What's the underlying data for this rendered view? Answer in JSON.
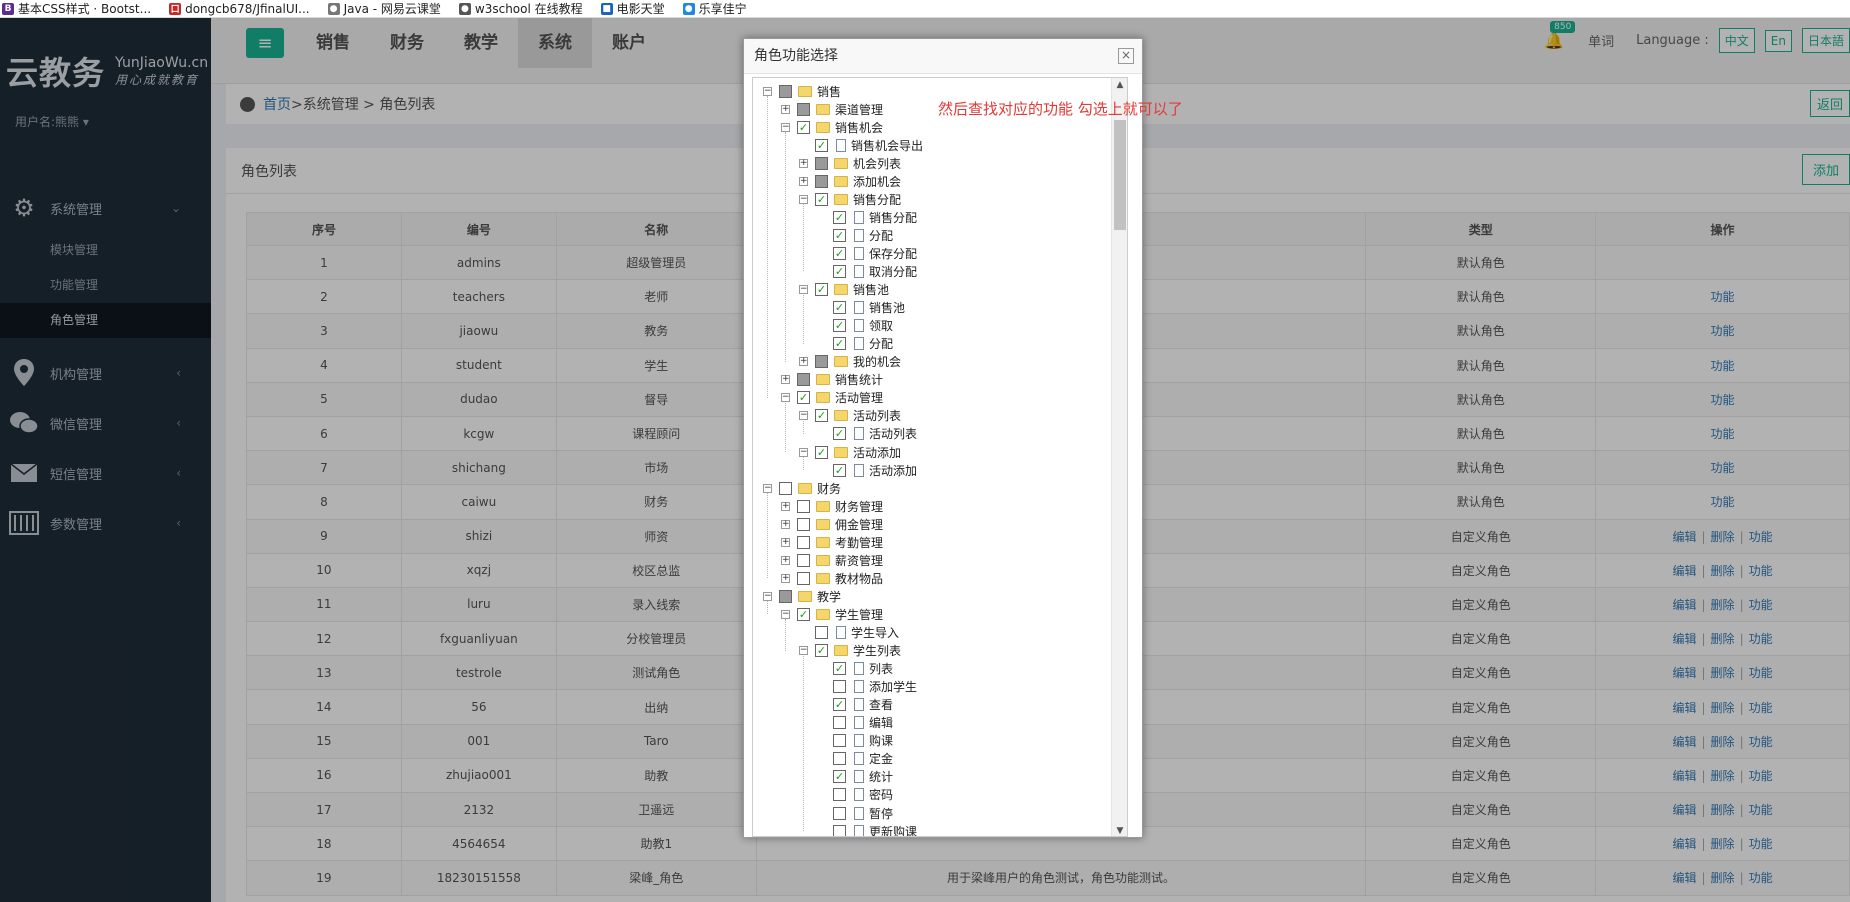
{
  "bookmarks": [
    {
      "icon": "B",
      "color": "#5c2d91",
      "label": "基本CSS样式 · Bootst..."
    },
    {
      "icon": "口",
      "color": "#c62828",
      "label": "dongcb678/JfinalUI..."
    },
    {
      "icon": "●",
      "color": "#777777",
      "label": "Java - 网易云课堂"
    },
    {
      "icon": "●",
      "color": "#555555",
      "label": "w3school 在线教程"
    },
    {
      "icon": "■",
      "color": "#1565c0",
      "label": "电影天堂"
    },
    {
      "icon": "●",
      "color": "#1e88e5",
      "label": "乐享佳宁"
    }
  ],
  "brand": {
    "name_cn": "云教务",
    "name_en": "YunJiaoWu.cn",
    "slogan": "用心成就教育"
  },
  "user": {
    "label": "用户名:熊熊 ▾"
  },
  "sidebar": {
    "system": {
      "label": "系统管理",
      "icon": "gear-icon",
      "sub": [
        "模块管理",
        "功能管理",
        "角色管理"
      ]
    },
    "items": [
      {
        "label": "机构管理",
        "icon": "location-icon"
      },
      {
        "label": "微信管理",
        "icon": "wechat-icon"
      },
      {
        "label": "短信管理",
        "icon": "mail-icon"
      },
      {
        "label": "参数管理",
        "icon": "sliders-icon"
      }
    ]
  },
  "topbar": {
    "menu_icon": "≡",
    "tabs": [
      "销售",
      "财务",
      "教学",
      "系统",
      "账户"
    ],
    "badge": "850",
    "word_label": "单词",
    "language_label": "Language :",
    "languages": [
      "中文",
      "En",
      "日本語"
    ]
  },
  "breadcrumb": {
    "home": "首页",
    "trail": " >系统管理 > 角色列表",
    "back": "返回"
  },
  "panel": {
    "title": "角色列表",
    "add": "添加"
  },
  "table": {
    "headers": [
      "序号",
      "编号",
      "名称",
      "",
      "类型",
      "操作"
    ],
    "op_labels": {
      "edit": "编辑",
      "delete": "删除",
      "func": "功能"
    },
    "rows": [
      {
        "no": "1",
        "code": "admins",
        "name": "超级管理员",
        "desc": "",
        "type": "默认角色",
        "ops": "none"
      },
      {
        "no": "2",
        "code": "teachers",
        "name": "老师",
        "desc": "",
        "type": "默认角色",
        "ops": "func"
      },
      {
        "no": "3",
        "code": "jiaowu",
        "name": "教务",
        "desc": "",
        "type": "默认角色",
        "ops": "func"
      },
      {
        "no": "4",
        "code": "student",
        "name": "学生",
        "desc": "",
        "type": "默认角色",
        "ops": "func"
      },
      {
        "no": "5",
        "code": "dudao",
        "name": "督导",
        "desc": "",
        "type": "默认角色",
        "ops": "func"
      },
      {
        "no": "6",
        "code": "kcgw",
        "name": "课程顾问",
        "desc": "",
        "type": "默认角色",
        "ops": "func"
      },
      {
        "no": "7",
        "code": "shichang",
        "name": "市场",
        "desc": "",
        "type": "默认角色",
        "ops": "func"
      },
      {
        "no": "8",
        "code": "caiwu",
        "name": "财务",
        "desc": "",
        "type": "默认角色",
        "ops": "func"
      },
      {
        "no": "9",
        "code": "shizi",
        "name": "师资",
        "desc": "",
        "type": "自定义角色",
        "ops": "all"
      },
      {
        "no": "10",
        "code": "xqzj",
        "name": "校区总监",
        "desc": "",
        "type": "自定义角色",
        "ops": "all"
      },
      {
        "no": "11",
        "code": "luru",
        "name": "录入线索",
        "desc": "",
        "type": "自定义角色",
        "ops": "all"
      },
      {
        "no": "12",
        "code": "fxguanliyuan",
        "name": "分校管理员",
        "desc": "",
        "type": "自定义角色",
        "ops": "all"
      },
      {
        "no": "13",
        "code": "testrole",
        "name": "测试角色",
        "desc": "",
        "type": "自定义角色",
        "ops": "all"
      },
      {
        "no": "14",
        "code": "56",
        "name": "出纳",
        "desc": "",
        "type": "自定义角色",
        "ops": "all"
      },
      {
        "no": "15",
        "code": "001",
        "name": "Taro",
        "desc": "",
        "type": "自定义角色",
        "ops": "all"
      },
      {
        "no": "16",
        "code": "zhujiao001",
        "name": "助教",
        "desc": "",
        "type": "自定义角色",
        "ops": "all"
      },
      {
        "no": "17",
        "code": "2132",
        "name": "卫遥远",
        "desc": "",
        "type": "自定义角色",
        "ops": "all"
      },
      {
        "no": "18",
        "code": "4564654",
        "name": "助教1",
        "desc": "",
        "type": "自定义角色",
        "ops": "all"
      },
      {
        "no": "19",
        "code": "18230151558",
        "name": "梁峰_角色",
        "desc": "用于梁峰用户的角色测试，角色功能测试。",
        "type": "自定义角色",
        "ops": "all"
      }
    ]
  },
  "modal": {
    "title": "角色功能选择",
    "close": "×",
    "tree": [
      {
        "d": 0,
        "t": "folder",
        "exp": "-",
        "s": "partial",
        "label": "销售"
      },
      {
        "d": 1,
        "t": "folder",
        "exp": "+",
        "s": "partial",
        "label": "渠道管理"
      },
      {
        "d": 1,
        "t": "folder",
        "exp": "-",
        "s": "checked",
        "label": "销售机会"
      },
      {
        "d": 2,
        "t": "file",
        "exp": "",
        "s": "checked",
        "label": "销售机会导出"
      },
      {
        "d": 2,
        "t": "folder",
        "exp": "+",
        "s": "partial",
        "label": "机会列表"
      },
      {
        "d": 2,
        "t": "folder",
        "exp": "+",
        "s": "partial",
        "label": "添加机会"
      },
      {
        "d": 2,
        "t": "folder",
        "exp": "-",
        "s": "checked",
        "label": "销售分配"
      },
      {
        "d": 3,
        "t": "file",
        "exp": "",
        "s": "checked",
        "label": "销售分配"
      },
      {
        "d": 3,
        "t": "file",
        "exp": "",
        "s": "checked",
        "label": "分配"
      },
      {
        "d": 3,
        "t": "file",
        "exp": "",
        "s": "checked",
        "label": "保存分配"
      },
      {
        "d": 3,
        "t": "file",
        "exp": "",
        "s": "checked",
        "label": "取消分配"
      },
      {
        "d": 2,
        "t": "folder",
        "exp": "-",
        "s": "checked",
        "label": "销售池"
      },
      {
        "d": 3,
        "t": "file",
        "exp": "",
        "s": "checked",
        "label": "销售池"
      },
      {
        "d": 3,
        "t": "file",
        "exp": "",
        "s": "checked",
        "label": "领取"
      },
      {
        "d": 3,
        "t": "file",
        "exp": "",
        "s": "checked",
        "label": "分配"
      },
      {
        "d": 2,
        "t": "folder",
        "exp": "+",
        "s": "partial",
        "label": "我的机会"
      },
      {
        "d": 1,
        "t": "folder",
        "exp": "+",
        "s": "partial",
        "label": "销售统计"
      },
      {
        "d": 1,
        "t": "folder",
        "exp": "-",
        "s": "checked",
        "label": "活动管理"
      },
      {
        "d": 2,
        "t": "folder",
        "exp": "-",
        "s": "checked",
        "label": "活动列表"
      },
      {
        "d": 3,
        "t": "file",
        "exp": "",
        "s": "checked",
        "label": "活动列表"
      },
      {
        "d": 2,
        "t": "folder",
        "exp": "-",
        "s": "checked",
        "label": "活动添加"
      },
      {
        "d": 3,
        "t": "file",
        "exp": "",
        "s": "checked",
        "label": "活动添加"
      },
      {
        "d": 0,
        "t": "folder",
        "exp": "-",
        "s": "unchecked",
        "label": "财务"
      },
      {
        "d": 1,
        "t": "folder",
        "exp": "+",
        "s": "unchecked",
        "label": "财务管理"
      },
      {
        "d": 1,
        "t": "folder",
        "exp": "+",
        "s": "unchecked",
        "label": "佣金管理"
      },
      {
        "d": 1,
        "t": "folder",
        "exp": "+",
        "s": "unchecked",
        "label": "考勤管理"
      },
      {
        "d": 1,
        "t": "folder",
        "exp": "+",
        "s": "unchecked",
        "label": "薪资管理"
      },
      {
        "d": 1,
        "t": "folder",
        "exp": "+",
        "s": "unchecked",
        "label": "教材物品"
      },
      {
        "d": 0,
        "t": "folder",
        "exp": "-",
        "s": "partial",
        "label": "教学"
      },
      {
        "d": 1,
        "t": "folder",
        "exp": "-",
        "s": "checked",
        "label": "学生管理"
      },
      {
        "d": 2,
        "t": "file",
        "exp": "",
        "s": "unchecked",
        "label": "学生导入"
      },
      {
        "d": 2,
        "t": "folder",
        "exp": "-",
        "s": "checked",
        "label": "学生列表"
      },
      {
        "d": 3,
        "t": "file",
        "exp": "",
        "s": "checked",
        "label": "列表"
      },
      {
        "d": 3,
        "t": "file",
        "exp": "",
        "s": "unchecked",
        "label": "添加学生"
      },
      {
        "d": 3,
        "t": "file",
        "exp": "",
        "s": "checked",
        "label": "查看"
      },
      {
        "d": 3,
        "t": "file",
        "exp": "",
        "s": "unchecked",
        "label": "编辑"
      },
      {
        "d": 3,
        "t": "file",
        "exp": "",
        "s": "unchecked",
        "label": "购课"
      },
      {
        "d": 3,
        "t": "file",
        "exp": "",
        "s": "unchecked",
        "label": "定金"
      },
      {
        "d": 3,
        "t": "file",
        "exp": "",
        "s": "checked",
        "label": "统计"
      },
      {
        "d": 3,
        "t": "file",
        "exp": "",
        "s": "unchecked",
        "label": "密码"
      },
      {
        "d": 3,
        "t": "file",
        "exp": "",
        "s": "unchecked",
        "label": "暂停"
      },
      {
        "d": 3,
        "t": "file",
        "exp": "",
        "s": "unchecked",
        "label": "更新购课"
      }
    ]
  },
  "annotation": "然后查找对应的功能 勾选上就可以了"
}
